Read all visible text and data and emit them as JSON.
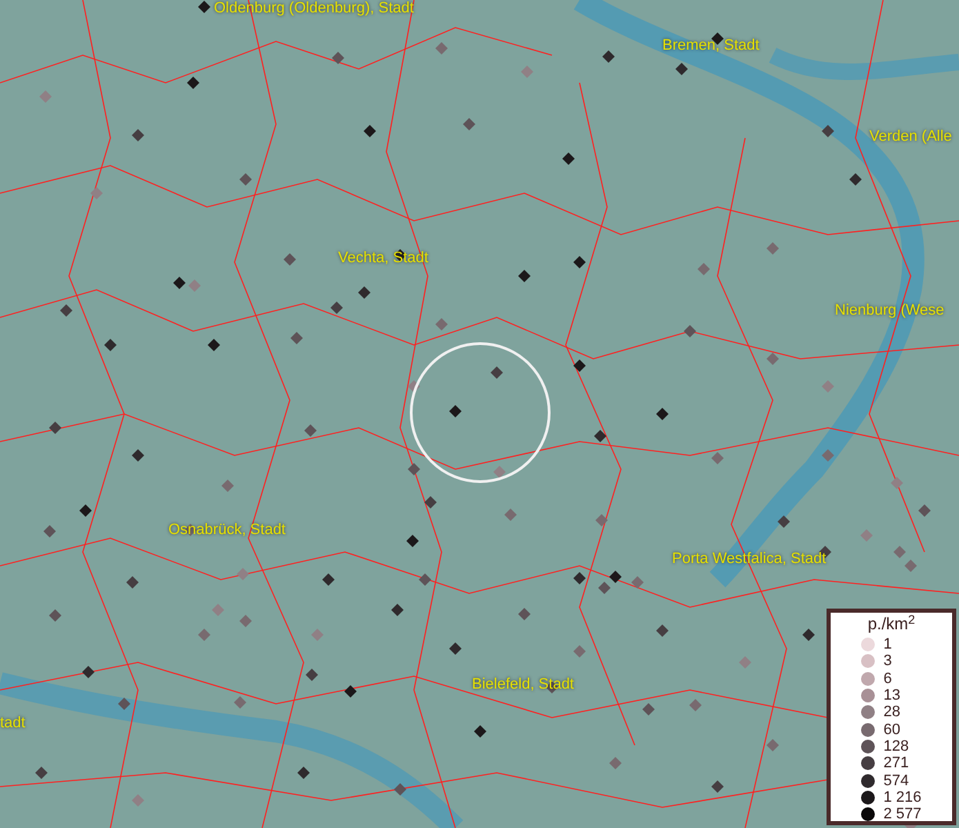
{
  "map": {
    "place_labels": [
      {
        "text": "Oldenburg (Oldenburg), Stadt"
      },
      {
        "text": "Bremen, Stadt"
      },
      {
        "text": "Verden (Alle"
      },
      {
        "text": "Vechta, Stadt"
      },
      {
        "text": "Nienburg (Wese"
      },
      {
        "text": "Osnabrück, Stadt"
      },
      {
        "text": "Porta Westfalica, Stadt"
      },
      {
        "text": "Bielefeld, Stadt"
      },
      {
        "text": "tadt"
      }
    ]
  },
  "legend": {
    "title": "p./km$^{2}$",
    "items": [
      {
        "label": "1",
        "color": "#ecd9dc"
      },
      {
        "label": "3",
        "color": "#d8c0c4"
      },
      {
        "label": "6",
        "color": "#c0a8ad"
      },
      {
        "label": "13",
        "color": "#a89096"
      },
      {
        "label": "28",
        "color": "#908085"
      },
      {
        "label": "60",
        "color": "#786a6f"
      },
      {
        "label": "128",
        "color": "#5e5358"
      },
      {
        "label": "271",
        "color": "#463e42"
      },
      {
        "label": "574",
        "color": "#2f2a2d"
      },
      {
        "label": "1 216",
        "color": "#1c181a"
      },
      {
        "label": "2 577",
        "color": "#0a0809"
      }
    ]
  }
}
